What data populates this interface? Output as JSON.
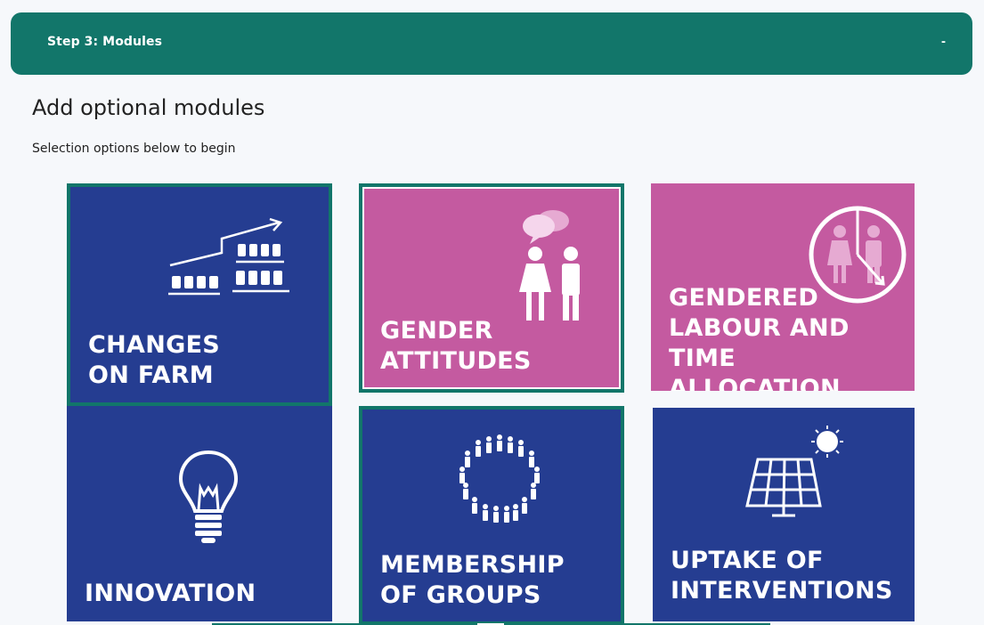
{
  "step": {
    "title": "Step 3: Modules",
    "toggle": "-"
  },
  "content": {
    "heading": "Add optional modules",
    "subtext": "Selection options below to begin"
  },
  "colors": {
    "accent": "#12766a",
    "tile_blue": "#253d91",
    "tile_pink": "#c45aa0"
  },
  "modules": [
    {
      "label": "CHANGES\nON FARM",
      "icon": "farm-growth-chart-icon",
      "color": "blue",
      "selected": true
    },
    {
      "label": "GENDER\nATTITUDES",
      "icon": "man-woman-speech-icon",
      "color": "pink",
      "selected": true
    },
    {
      "label": "GENDERED\nLABOUR AND\nTIME ALLOCATION",
      "icon": "clock-people-icon",
      "color": "pink",
      "selected": false
    },
    {
      "label": "INNOVATION",
      "icon": "lightbulb-icon",
      "color": "blue",
      "selected": false
    },
    {
      "label": "MEMBERSHIP\nOF GROUPS",
      "icon": "people-circle-icon",
      "color": "blue",
      "selected": true
    },
    {
      "label": "UPTAKE OF\nINTERVENTIONS",
      "icon": "solar-panel-icon",
      "color": "blue",
      "selected": false
    }
  ]
}
